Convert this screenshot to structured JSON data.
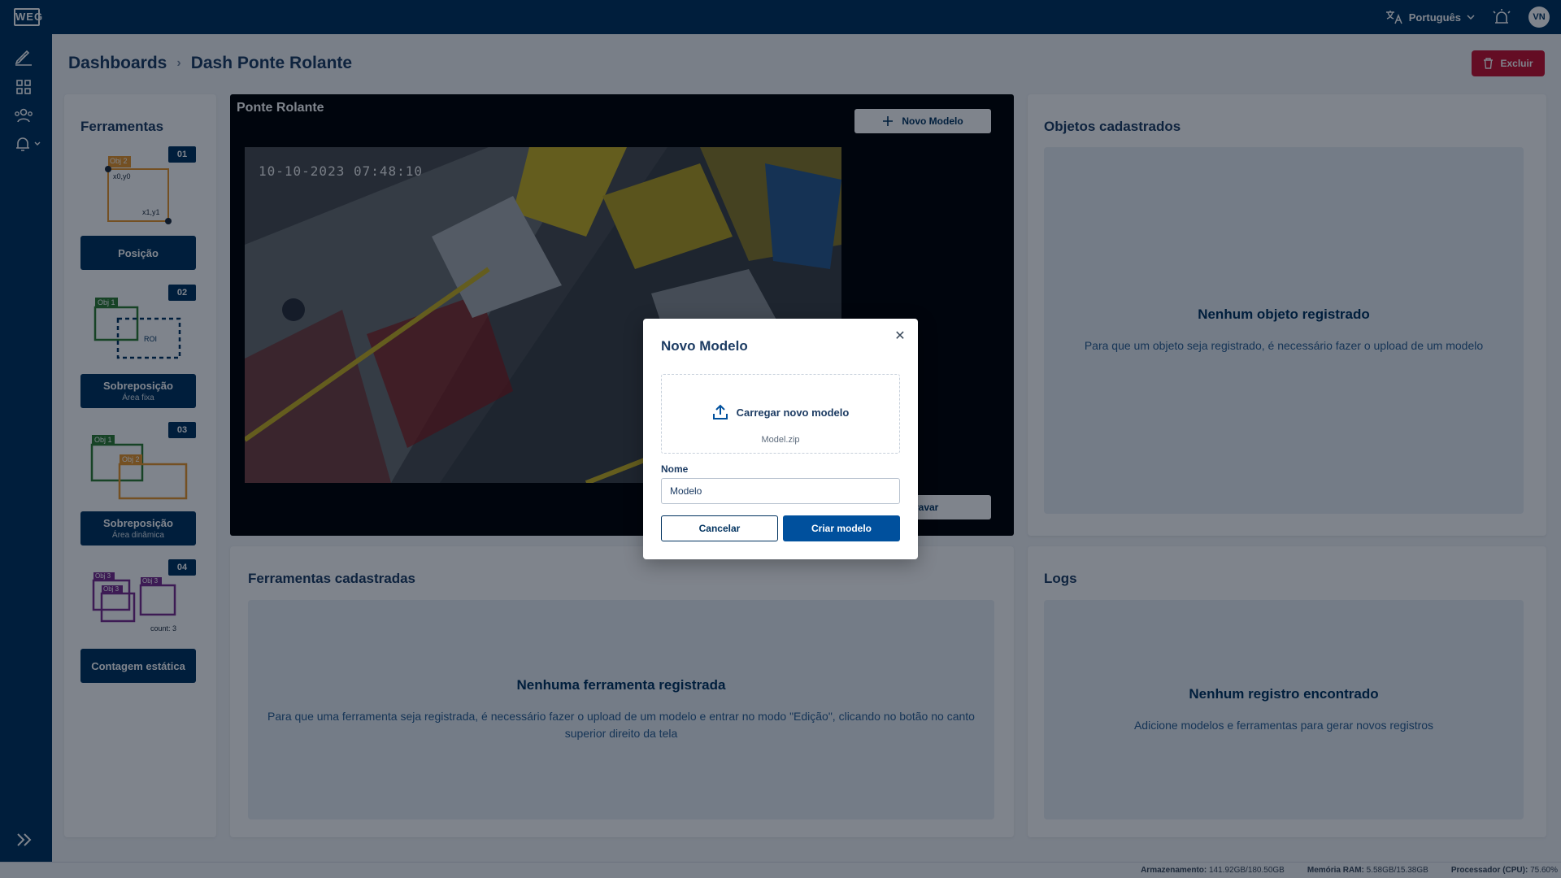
{
  "app": {
    "logo_text": "WEG"
  },
  "topbar": {
    "language": "Português",
    "avatar_initials": "VN"
  },
  "breadcrumb": {
    "root": "Dashboards",
    "separator": "›",
    "current": "Dash Ponte Rolante"
  },
  "header": {
    "delete_label": "Excluir"
  },
  "tools_panel": {
    "title": "Ferramentas",
    "items": [
      {
        "num": "01",
        "label": "Posição",
        "sub": "",
        "tags": [
          "Obj 2",
          "x0,y0",
          "x1,y1"
        ]
      },
      {
        "num": "02",
        "label": "Sobreposição",
        "sub": "Área fixa",
        "tags": [
          "Obj 1",
          "ROI"
        ]
      },
      {
        "num": "03",
        "label": "Sobreposição",
        "sub": "Área dinâmica",
        "tags": [
          "Obj 1",
          "Obj 2"
        ]
      },
      {
        "num": "04",
        "label": "Contagem estática",
        "sub": "",
        "tags": [
          "Obj 3",
          "Obj 3",
          "Obj 3",
          "count: 3"
        ]
      }
    ]
  },
  "video_panel": {
    "title": "Ponte Rolante",
    "new_model_label": "Novo Modelo",
    "record_label": "Gravar",
    "timestamp": "10-10-2023 07:48:10"
  },
  "objects_panel": {
    "title": "Objetos cadastrados",
    "empty_title": "Nenhum objeto registrado",
    "empty_desc": "Para que um objeto seja registrado, é necessário fazer o upload de um modelo"
  },
  "registered_tools_panel": {
    "title": "Ferramentas cadastradas",
    "empty_title": "Nenhuma ferramenta registrada",
    "empty_desc": "Para que uma ferramenta seja registrada, é necessário fazer o upload de um modelo e entrar no modo \"Edição\", clicando no botão no canto superior direito da tela"
  },
  "logs_panel": {
    "title": "Logs",
    "empty_title": "Nenhum registro encontrado",
    "empty_desc": "Adicione modelos e ferramentas para gerar novos registros"
  },
  "modal": {
    "title": "Novo Modelo",
    "upload_label": "Carregar novo modelo",
    "upload_file": "Model.zip",
    "name_label": "Nome",
    "name_value": "Modelo",
    "cancel_label": "Cancelar",
    "create_label": "Criar modelo"
  },
  "statusbar": {
    "storage_label": "Armazenamento:",
    "storage_value": "141.92GB/180.50GB",
    "ram_label": "Memória RAM:",
    "ram_value": "5.58GB/15.38GB",
    "cpu_label": "Processador (CPU):",
    "cpu_value": "75.60%"
  },
  "colors": {
    "brand": "#00325f",
    "danger": "#c8102e",
    "accent": "#00509d"
  }
}
